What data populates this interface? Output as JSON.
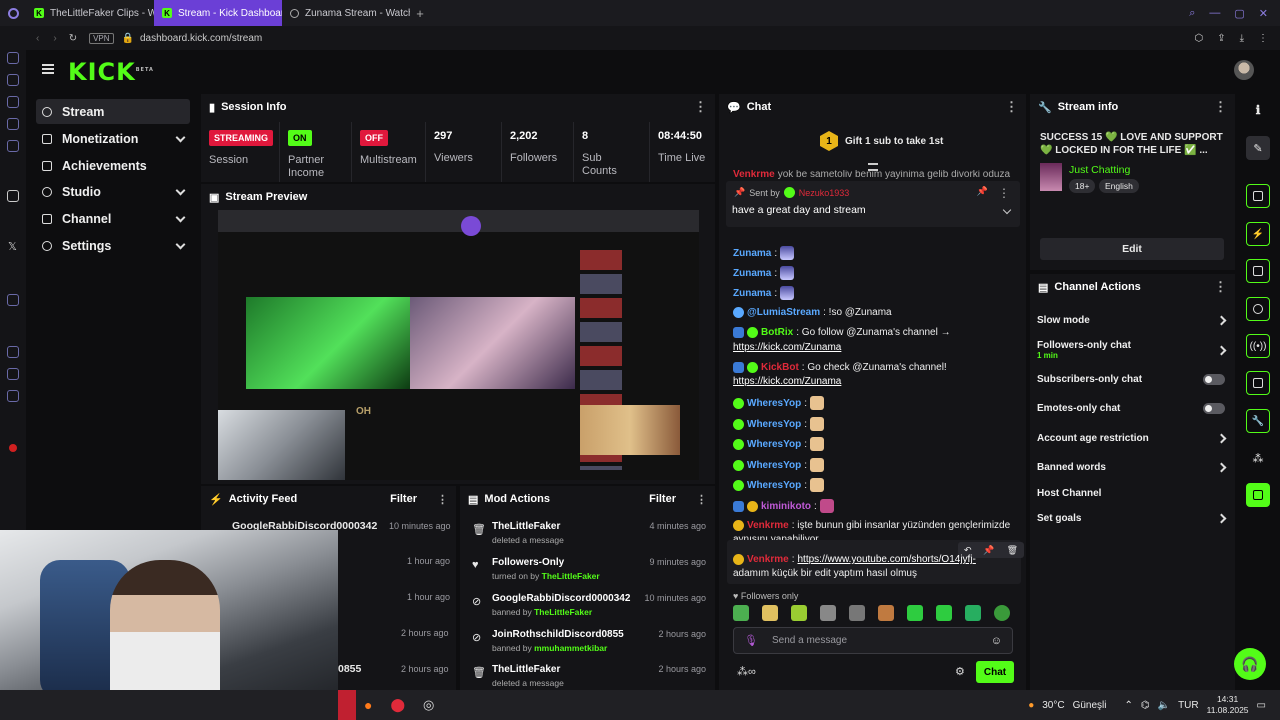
{
  "browser": {
    "tabs": [
      {
        "label": "TheLittleFaker Clips - Wa"
      },
      {
        "label": "Stream - Kick Dashboard"
      },
      {
        "label": "Zunama Stream - Watch a"
      }
    ],
    "vpn": "VPN",
    "url": "dashboard.kick.com/stream"
  },
  "logo": "KICK",
  "logo_sup": "BETA",
  "nav": [
    {
      "label": "Stream"
    },
    {
      "label": "Monetization"
    },
    {
      "label": "Achievements"
    },
    {
      "label": "Studio"
    },
    {
      "label": "Channel"
    },
    {
      "label": "Settings"
    }
  ],
  "session": {
    "title": "Session Info",
    "streaming_badge": "STREAMING",
    "session_label": "Session",
    "partner_badge": "ON",
    "partner_label": "Partner Income",
    "multistream_badge": "OFF",
    "multistream_label": "Multistream",
    "viewers": "297",
    "viewers_label": "Viewers",
    "followers": "2,202",
    "followers_label": "Followers",
    "subs": "8",
    "subs_label": "Sub Counts",
    "time_live": "08:44:50",
    "time_live_label": "Time Live"
  },
  "preview": {
    "title": "Stream Preview",
    "overlay": "OH"
  },
  "activity": {
    "title": "Activity Feed",
    "filter": "Filter",
    "items": [
      {
        "name": "GoogleRabbiDiscord0000342",
        "time": "10 minutes ago"
      },
      {
        "name": "",
        "time": "1 hour ago"
      },
      {
        "name": "",
        "time": "1 hour ago"
      },
      {
        "name": "",
        "time": "2 hours ago"
      },
      {
        "name": "0855",
        "time": "2 hours ago"
      }
    ]
  },
  "mod": {
    "title": "Mod Actions",
    "filter": "Filter",
    "items": [
      {
        "title": "TheLittleFaker",
        "sub": "deleted a message",
        "by": "",
        "time": "4 minutes ago"
      },
      {
        "title": "Followers-Only",
        "sub": "turned on by ",
        "by": "TheLittleFaker",
        "time": "9 minutes ago"
      },
      {
        "title": "GoogleRabbiDiscord0000342",
        "sub": "banned by ",
        "by": "TheLittleFaker",
        "time": "10 minutes ago"
      },
      {
        "title": "JoinRothschildDiscord0855",
        "sub": "banned by ",
        "by": "mmuhammetkibar",
        "time": "2 hours ago"
      },
      {
        "title": "TheLittleFaker",
        "sub": "deleted a message",
        "by": "",
        "time": "2 hours ago"
      }
    ]
  },
  "chat": {
    "title": "Chat",
    "gift_num": "1",
    "gift": "Gift 1 sub to take 1st",
    "top_cut": "yok be sametoliv benim yayinima gelib divorki oduza",
    "top_cut_user": "Venkrme",
    "pinned_sent_by": "Sent by",
    "pinned_user": "Nezuko1933",
    "pinned_msg": "have a great day and stream",
    "lines": [
      {
        "user": "Zunama",
        "color": "#5aa9ff",
        "text": ":"
      },
      {
        "user": "Zunama",
        "color": "#5aa9ff",
        "text": ":"
      },
      {
        "user": "Zunama",
        "color": "#5aa9ff",
        "text": ":"
      },
      {
        "user": "Zunama",
        "color": "#5aa9ff",
        "text": ":"
      }
    ],
    "lumia_user": "@LumiaStream",
    "lumia_text": ": !so @Zunama",
    "botrix_user": "BotRix",
    "botrix_text": ": Go follow @Zunama's channel →",
    "botrix_link": "https://kick.com/Zunama",
    "kickbot_user": "KickBot",
    "kickbot_text": ": Go check @Zunama's channel!",
    "kickbot_link": "https://kick.com/Zunama",
    "wheres": "WheresYop",
    "kimi": "kiminikoto",
    "venk1_user": "Venkrme",
    "venk1_text": ": işte bunun gibi insanlar yüzünden gençlerimizde",
    "venk1_text2": "aynısını yapabiliyor",
    "venk2_user": "Venkrme",
    "venk2_link": "https://www.youtube.com/shorts/O14jyfj-",
    "venk2_text2": "adamım küçük bir edit yaptım hasıl olmuş",
    "followers_only": "Followers only",
    "placeholder": "Send a message",
    "send": "Chat"
  },
  "streaminfo": {
    "title": "Stream info",
    "stream_title": "SUCCESS 15 💚 LOVE AND SUPPORT 💚 LOCKED IN FOR THE LIFE ✅ ...",
    "category": "Just Chatting",
    "tag1": "18+",
    "tag2": "English",
    "edit": "Edit"
  },
  "actions": {
    "title": "Channel Actions",
    "slow": "Slow mode",
    "followers_only": "Followers-only chat",
    "followers_only_sub": "1 min",
    "subs_only": "Subscribers-only chat",
    "emotes_only": "Emotes-only chat",
    "age": "Account age restriction",
    "banned": "Banned words",
    "host": "Host Channel",
    "goals": "Set goals"
  },
  "taskbar": {
    "weather": "30°C",
    "weather_label": "Güneşli",
    "lang": "TUR",
    "time": "14:31",
    "date": "11.08.2025"
  }
}
